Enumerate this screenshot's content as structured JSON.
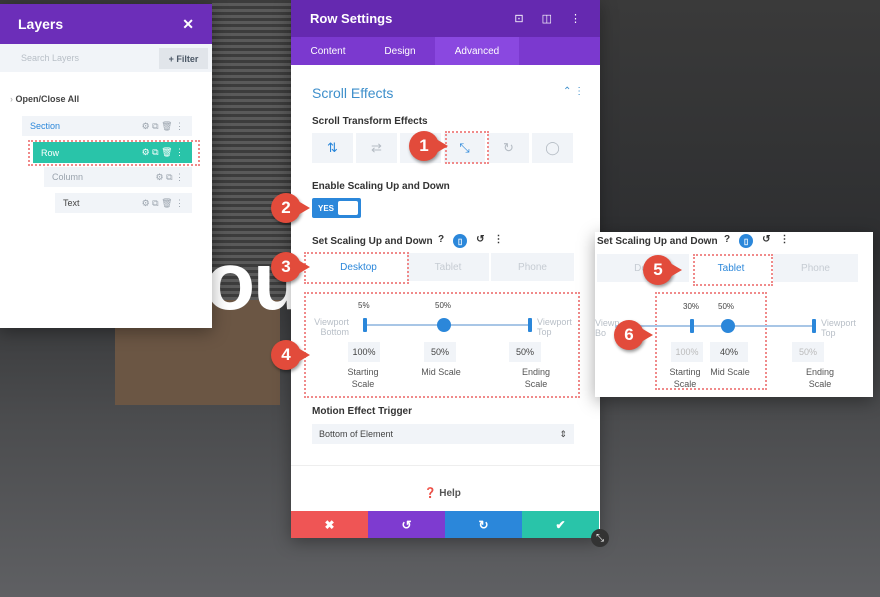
{
  "background_text": "ou",
  "layers": {
    "title": "Layers",
    "close": "✕",
    "search_placeholder": "Search Layers",
    "filter": "+ Filter",
    "open_close": "Open/Close All",
    "items": [
      {
        "label": "Section"
      },
      {
        "label": "Row"
      },
      {
        "label": "Column"
      },
      {
        "label": "Text"
      }
    ]
  },
  "settings": {
    "title": "Row Settings",
    "tabs": [
      "Content",
      "Design",
      "Advanced"
    ],
    "active_tab": "Advanced",
    "section_title": "Scroll Effects",
    "scroll_transform_label": "Scroll Transform Effects",
    "effects": [
      "vertical-motion-icon",
      "horizontal-motion-icon",
      "fade-icon",
      "scaling-icon",
      "rotating-icon",
      "blur-icon"
    ],
    "enable_label": "Enable Scaling Up and Down",
    "toggle": "YES",
    "set_label": "Set Scaling Up and Down",
    "devices": [
      "Desktop",
      "Tablet",
      "Phone"
    ],
    "desktop": {
      "start_pct": "5%",
      "mid_pct": "50%",
      "viewport_bottom": "Viewport Bottom",
      "viewport_top": "Viewport Top",
      "starting": "100%",
      "mid": "50%",
      "ending": "50%",
      "starting_label": "Starting Scale",
      "mid_label": "Mid Scale",
      "ending_label": "Ending Scale"
    },
    "trigger_label": "Motion Effect Trigger",
    "trigger_value": "Bottom of Element",
    "help": "Help"
  },
  "tablet_panel": {
    "set_label": "Set Scaling Up and Down",
    "devices": [
      "Des",
      "Tablet",
      "Phone"
    ],
    "start_pct": "30%",
    "mid_pct": "50%",
    "viewport_bottom": "Viewp Bo",
    "viewport_top": "Viewport Top",
    "starting": "100%",
    "mid": "40%",
    "ending": "50%",
    "starting_label": "Starting Scale",
    "mid_label": "Mid Scale",
    "ending_label": "Ending Scale"
  },
  "badges": [
    "1",
    "2",
    "3",
    "4",
    "5",
    "6"
  ],
  "colors": {
    "purple": "#6c2eb9",
    "blue": "#2b87da",
    "teal": "#29c4a9",
    "red": "#ef5555",
    "badge": "#e24b3b"
  }
}
